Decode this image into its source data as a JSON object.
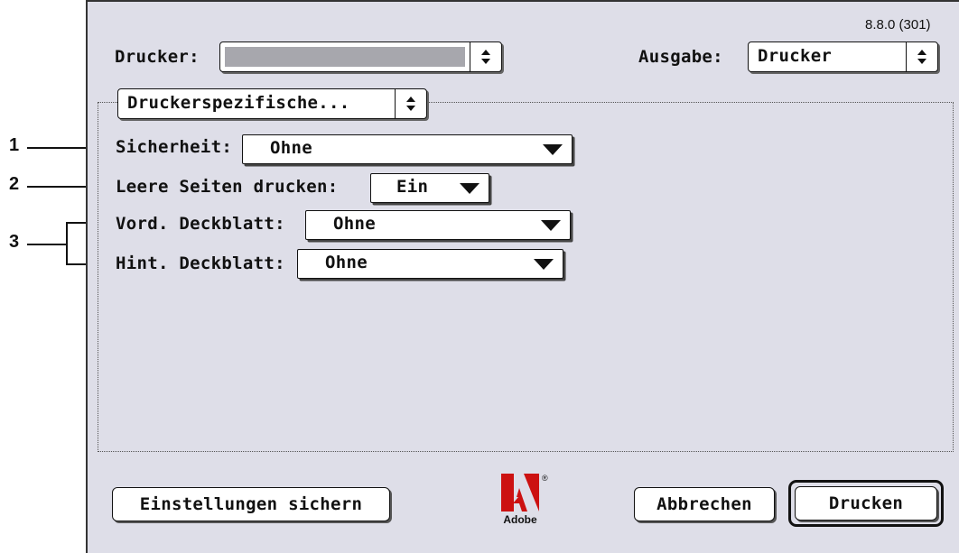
{
  "dialog": {
    "version": "8.8.0 (301)",
    "printer_label": "Drucker:",
    "printer_value": "",
    "output_label": "Ausgabe:",
    "output_value": "Drucker",
    "panel_popup": "Druckerspezifische..."
  },
  "settings": [
    {
      "label": "Sicherheit:",
      "value": "Ohne"
    },
    {
      "label": "Leere Seiten drucken:",
      "value": "Ein"
    },
    {
      "label": "Vord. Deckblatt:",
      "value": "Ohne"
    },
    {
      "label": "Hint. Deckblatt:",
      "value": "Ohne"
    }
  ],
  "callouts": [
    "1",
    "2",
    "3"
  ],
  "buttons": {
    "save_settings": "Einstellungen sichern",
    "cancel": "Abbrechen",
    "print": "Drucken"
  },
  "logo": {
    "name": "Adobe",
    "text": "Adobe",
    "color": "#cc1111"
  },
  "icons": {
    "stepper": "up-down-arrows-icon",
    "dropdown": "triangle-down-icon"
  }
}
